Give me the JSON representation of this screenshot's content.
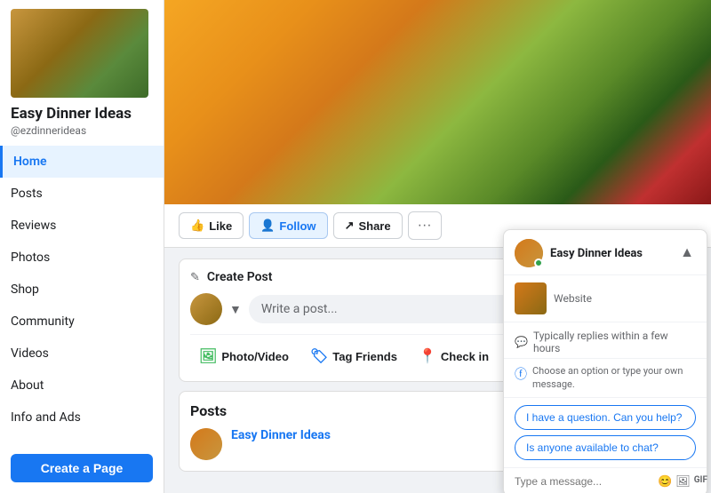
{
  "sidebar": {
    "page_name": "Easy Dinner Ideas",
    "handle": "@ezdinnerideas",
    "nav_items": [
      {
        "id": "home",
        "label": "Home",
        "active": true
      },
      {
        "id": "posts",
        "label": "Posts",
        "active": false
      },
      {
        "id": "reviews",
        "label": "Reviews",
        "active": false
      },
      {
        "id": "photos",
        "label": "Photos",
        "active": false
      },
      {
        "id": "shop",
        "label": "Shop",
        "active": false
      },
      {
        "id": "community",
        "label": "Community",
        "active": false
      },
      {
        "id": "videos",
        "label": "Videos",
        "active": false
      },
      {
        "id": "about",
        "label": "About",
        "active": false
      },
      {
        "id": "info-and-ads",
        "label": "Info and Ads",
        "active": false
      }
    ],
    "create_page_btn": "Create a Page"
  },
  "action_bar": {
    "like_label": "Like",
    "follow_label": "Follow",
    "share_label": "Share",
    "more_symbol": "···"
  },
  "create_post": {
    "section_label": "Create Post",
    "placeholder": "Write a post...",
    "photo_video_label": "Photo/Video",
    "tag_friends_label": "Tag Friends",
    "check_in_label": "Check in"
  },
  "posts": {
    "section_title": "Posts",
    "post_user_name": "Easy Dinner Ideas"
  },
  "chat": {
    "page_name": "Easy Dinner Ideas",
    "website_label": "Website",
    "reply_time": "Typically replies within a few hours",
    "fb_message": "Choose an option or type your own message.",
    "suggestion1": "I have a question. Can you help?",
    "suggestion2": "Is anyone available to chat?",
    "input_placeholder": "Type a message...",
    "close_symbol": "×",
    "scroll_up": "▲"
  },
  "icons": {
    "pencil": "✎",
    "like_thumb": "👍",
    "follow_person": "👤",
    "share_arrow": "↗",
    "photo": "🖼",
    "tag": "🏷",
    "checkin": "📍",
    "chat_reply": "💬",
    "fb_messenger": "ⓕ",
    "send": "➤",
    "emoji": "😊",
    "image": "🖼",
    "gif": "GIF",
    "like_chat": "👍"
  }
}
